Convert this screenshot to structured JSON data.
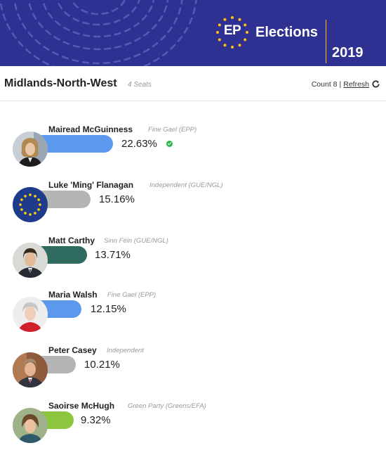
{
  "banner": {
    "brand_short": "EP",
    "brand_word": "Elections",
    "year": "2019",
    "colors": {
      "background": "#2e3192",
      "accent": "#ffc20e"
    }
  },
  "header": {
    "constituency": "Midlands-North-West",
    "seats": "4 Seats",
    "count_label": "Count 8",
    "separator": "|",
    "refresh_label": "Refresh",
    "refresh_icon": "refresh-icon"
  },
  "candidates": [
    {
      "name": "Mairead McGuinness",
      "party": "Fine Gael (EPP)",
      "percent": "22.63%",
      "share": 22.63,
      "color": "#5b98ee",
      "elected": true
    },
    {
      "name": "Luke 'Ming' Flanagan",
      "party": "Independent (GUE/NGL)",
      "percent": "15.16%",
      "share": 15.16,
      "color": "#b5b5b5",
      "elected": false
    },
    {
      "name": "Matt Carthy",
      "party": "Sinn Féin (GUE/NGL)",
      "percent": "13.71%",
      "share": 13.71,
      "color": "#2e6b5e",
      "elected": false
    },
    {
      "name": "Maria Walsh",
      "party": "Fine Gael (EPP)",
      "percent": "12.15%",
      "share": 12.15,
      "color": "#5b98ee",
      "elected": false
    },
    {
      "name": "Peter Casey",
      "party": "Independent",
      "percent": "10.21%",
      "share": 10.21,
      "color": "#b5b5b5",
      "elected": false
    },
    {
      "name": "Saoirse McHugh",
      "party": "Green Party (Greens/EFA)",
      "percent": "9.32%",
      "share": 9.32,
      "color": "#8cc63f",
      "elected": false
    }
  ]
}
